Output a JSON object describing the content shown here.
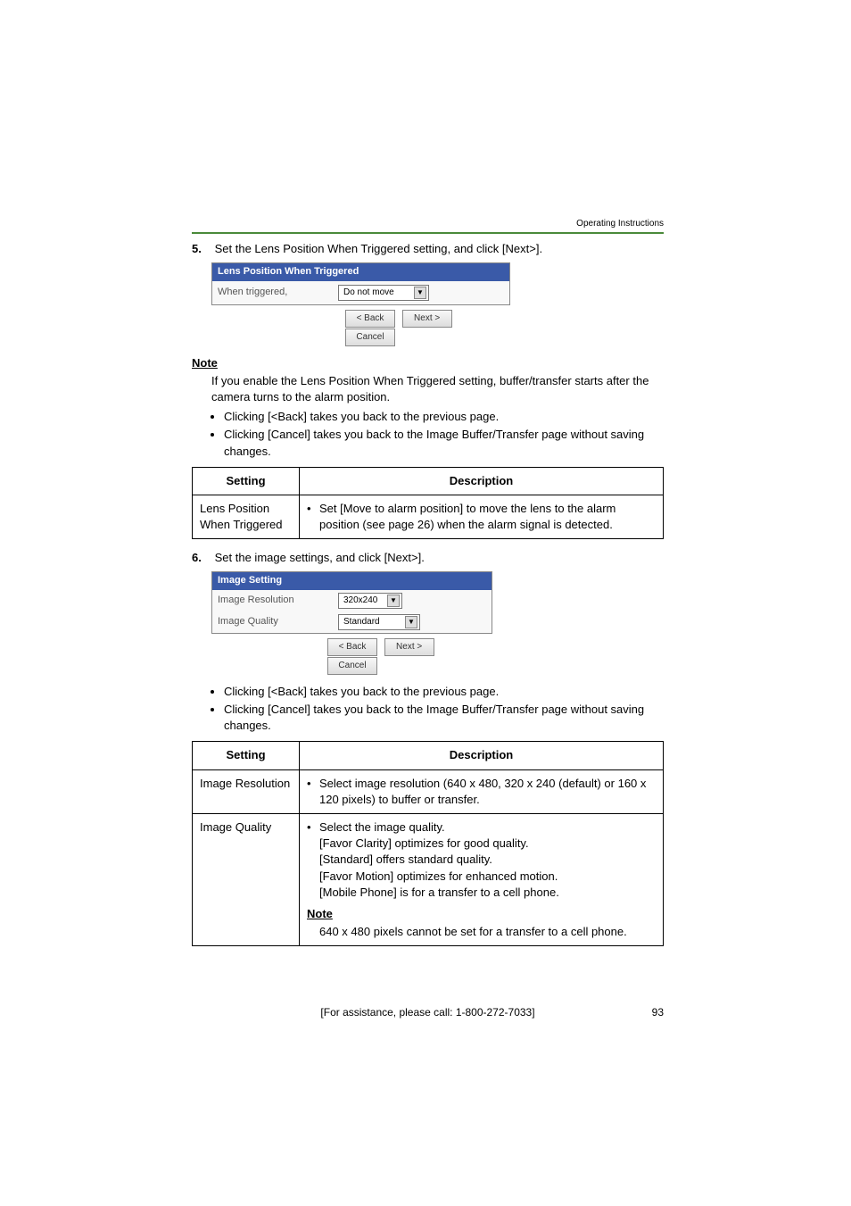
{
  "header": {
    "doc_label": "Operating Instructions"
  },
  "step5": {
    "num": "5.",
    "text": "Set the Lens Position When Triggered setting, and click [Next>].",
    "panel": {
      "title": "Lens Position When Triggered",
      "row_label": "When triggered,",
      "dropdown_value": "Do not move",
      "btn_back": "< Back",
      "btn_next": "Next >",
      "btn_cancel": "Cancel"
    },
    "note_title": "Note",
    "note_body": "If you enable the Lens Position When Triggered setting, buffer/transfer starts after the camera turns to the alarm position.",
    "bullets": [
      "Clicking [<Back] takes you back to the previous page.",
      "Clicking [Cancel] takes you back to the Image Buffer/Transfer page without saving changes."
    ],
    "table": {
      "h1": "Setting",
      "h2": "Description",
      "r1c1": "Lens Position When Triggered",
      "r1c2": "Set [Move to alarm position] to move the lens to the alarm position (see page 26) when the alarm signal is detected."
    }
  },
  "step6": {
    "num": "6.",
    "text": "Set the image settings, and click [Next>].",
    "panel": {
      "title": "Image Setting",
      "row1_label": "Image Resolution",
      "row1_value": "320x240",
      "row2_label": "Image Quality",
      "row2_value": "Standard",
      "btn_back": "< Back",
      "btn_next": "Next >",
      "btn_cancel": "Cancel"
    },
    "bullets": [
      "Clicking [<Back] takes you back to the previous page.",
      "Clicking [Cancel] takes you back to the Image Buffer/Transfer page without saving changes."
    ],
    "table": {
      "h1": "Setting",
      "h2": "Description",
      "r1c1": "Image Resolution",
      "r1c2": "Select image resolution (640 x 480, 320 x 240 (default) or 160 x 120 pixels) to buffer or transfer.",
      "r2c1": "Image Quality",
      "r2c2_lines": [
        "Select the image quality.",
        "[Favor Clarity] optimizes for good quality.",
        "[Standard] offers standard quality.",
        "[Favor Motion] optimizes for enhanced motion.",
        "[Mobile Phone] is for a transfer to a cell phone."
      ],
      "r2_note_title": "Note",
      "r2_note_body": "640 x 480 pixels cannot be set for a transfer to a cell phone."
    }
  },
  "footer": {
    "assist": "[For assistance, please call: 1-800-272-7033]",
    "page": "93"
  }
}
